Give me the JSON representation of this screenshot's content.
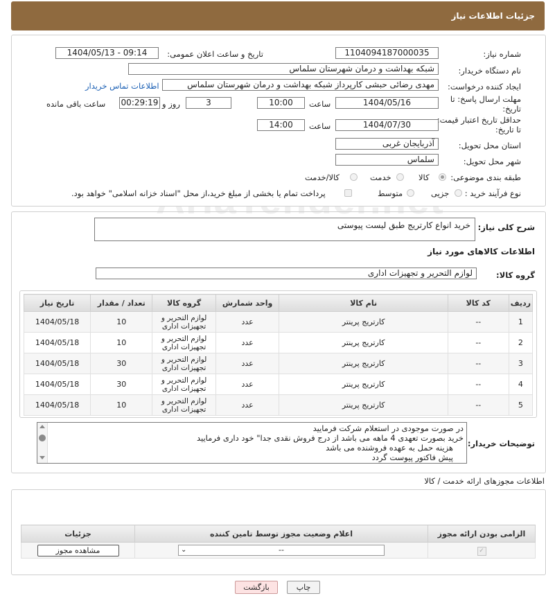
{
  "header": {
    "title": "جزئیات اطلاعات نیاز"
  },
  "watermark": "AriaTender.net",
  "form": {
    "need_number": {
      "label": "شماره نیاز:",
      "value": "1104094187000035"
    },
    "announce_datetime": {
      "label": "تاریخ و ساعت اعلان عمومی:",
      "value": "1404/05/13 - 09:14"
    },
    "buyer_org": {
      "label": "نام دستگاه خریدار:",
      "value": "شبکه بهداشت و درمان  شهرستان سلماس"
    },
    "requester": {
      "label": "ایجاد کننده درخواست:",
      "value": "مهدی رضائی حبشی کارپرداز شبکه بهداشت و درمان  شهرستان سلماس",
      "contact_link": "اطلاعات تماس خریدار"
    },
    "reply_deadline": {
      "label": "مهلت ارسال پاسخ: تا تاریخ:",
      "date": "1404/05/16",
      "time_label": "ساعت",
      "time": "10:00",
      "days": "3",
      "days_label": "روز و",
      "remaining": "00:29:19",
      "remaining_label": "ساعت باقی مانده"
    },
    "price_validity": {
      "label": "حداقل تاریخ اعتبار قیمت: تا تاریخ:",
      "date": "1404/07/30",
      "time_label": "ساعت",
      "time": "14:00"
    },
    "province": {
      "label": "استان محل تحویل:",
      "value": "آذربایجان غربی"
    },
    "city": {
      "label": "شهر محل تحویل:",
      "value": "سلماس"
    },
    "category": {
      "label": "طبقه بندی موضوعی:",
      "options": [
        "کالا",
        "خدمت",
        "کالا/خدمت"
      ],
      "selected": "کالا"
    },
    "purchase_type": {
      "label": "نوع فرآیند خرید :",
      "options": [
        "جزیی",
        "متوسط"
      ],
      "payment_note": "پرداخت تمام یا بخشی از مبلغ خرید،از محل \"اسناد خزانه اسلامی\" خواهد بود."
    }
  },
  "description": {
    "label": "شرح کلی نیاز:",
    "value": "خرید انواع کارتریج طبق لیست پیوستی"
  },
  "goods": {
    "section_title": "اطلاعات کالاهای مورد نیاز",
    "group_label": "گروه کالا:",
    "group_value": "لوازم التحریر و تجهیزات اداری",
    "columns": [
      "ردیف",
      "کد کالا",
      "نام کالا",
      "واحد شمارش",
      "گروه کالا",
      "تعداد / مقدار",
      "تاریخ نیاز"
    ],
    "rows": [
      {
        "idx": "1",
        "code": "--",
        "name": "کارتریج پرینتر",
        "unit": "عدد",
        "group": "لوازم التحریر و تجهیزات اداری",
        "qty": "10",
        "date": "1404/05/18"
      },
      {
        "idx": "2",
        "code": "--",
        "name": "کارتریج پرینتر",
        "unit": "عدد",
        "group": "لوازم التحریر و تجهیزات اداری",
        "qty": "10",
        "date": "1404/05/18"
      },
      {
        "idx": "3",
        "code": "--",
        "name": "کارتریج پرینتر",
        "unit": "عدد",
        "group": "لوازم التحریر و تجهیزات اداری",
        "qty": "30",
        "date": "1404/05/18"
      },
      {
        "idx": "4",
        "code": "--",
        "name": "کارتریج پرینتر",
        "unit": "عدد",
        "group": "لوازم التحریر و تجهیزات اداری",
        "qty": "30",
        "date": "1404/05/18"
      },
      {
        "idx": "5",
        "code": "--",
        "name": "کارتریج پرینتر",
        "unit": "عدد",
        "group": "لوازم التحریر و تجهیزات اداری",
        "qty": "10",
        "date": "1404/05/18"
      }
    ]
  },
  "buyer_notes": {
    "label": "توضیحات خریدار:",
    "lines": [
      "در صورت موجودی در استعلام شرکت فرمایید",
      "خرید بصورت تعهدی 4 ماهه می باشد از درج فروش نقدی جدا\" خود داری فرمایید",
      "هزینه حمل به عهده فروشنده می باشد",
      "پیش فاکتور پیوست گردد"
    ]
  },
  "permits": {
    "title": "اطلاعات مجوزهای ارائه خدمت / کالا",
    "columns": [
      "الزامی بودن ارائه مجوز",
      "اعلام وضعیت مجوز توسط تامین کننده",
      "جزئیات"
    ],
    "select_value": "--",
    "view_button": "مشاهده مجوز"
  },
  "actions": {
    "print": "چاپ",
    "back": "بازگشت"
  }
}
